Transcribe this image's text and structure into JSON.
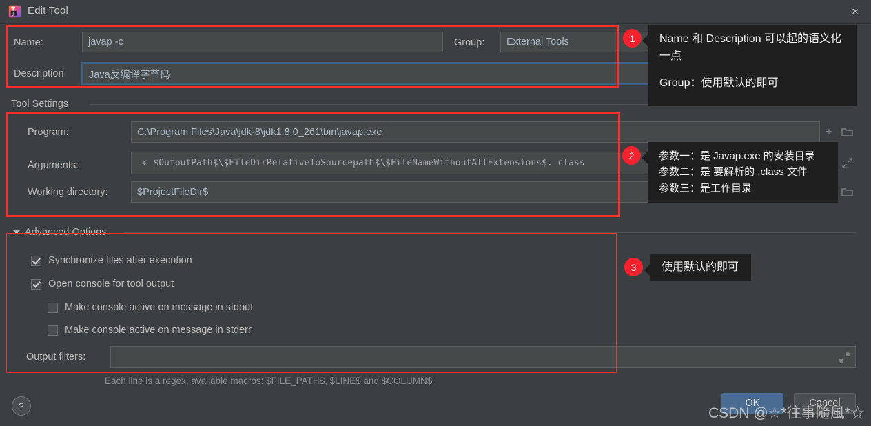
{
  "window": {
    "title": "Edit Tool",
    "app_icon": "intellij-idea-icon",
    "close_label": "×"
  },
  "form": {
    "name_label": "Name:",
    "name_value": "javap -c",
    "group_label": "Group:",
    "group_value": "External Tools",
    "description_label": "Description:",
    "description_value": "Java反编译字节码"
  },
  "tool_settings": {
    "section_title": "Tool Settings",
    "program_label": "Program:",
    "program_value": "C:\\Program Files\\Java\\jdk-8\\jdk1.8.0_261\\bin\\javap.exe",
    "arguments_label": "Arguments:",
    "arguments_value": "-c $OutputPath$\\$FileDirRelativeToSourcepath$\\$FileNameWithoutAllExtensions$. class",
    "working_directory_label": "Working directory:",
    "working_directory_value": "$ProjectFileDir$",
    "insert_macro_icon": "plus-icon",
    "browse_icon": "folder-icon",
    "expand_icon": "expand-icon"
  },
  "advanced": {
    "section_title": "Advanced Options",
    "collapse_icon": "chevron-down-icon",
    "checkboxes": [
      {
        "label": "Synchronize files after execution",
        "checked": true,
        "indent": false
      },
      {
        "label": "Open console for tool output",
        "checked": true,
        "indent": false
      },
      {
        "label": "Make console active on message in stdout",
        "checked": false,
        "indent": true
      },
      {
        "label": "Make console active on message in stderr",
        "checked": false,
        "indent": true
      }
    ],
    "output_filters_label": "Output filters:",
    "output_filters_value": "",
    "output_filters_expand_icon": "expand-icon",
    "hint": "Each line is a regex, available macros: $FILE_PATH$, $LINE$ and $COLUMN$"
  },
  "footer": {
    "help_label": "?",
    "ok_label": "OK",
    "cancel_label": "Cancel",
    "watermark": "CSDN @☆*往事隨風*☆"
  },
  "callouts": [
    {
      "number": "1",
      "lines": [
        "Name 和 Description 可以起的语义化",
        "一点",
        "",
        "Group：使用默认的即可"
      ]
    },
    {
      "number": "2",
      "lines": [
        "参数一：是 Javap.exe 的安装目录",
        "参数二：是 要解析的 .class 文件",
        "参数三：是工作目录"
      ]
    },
    {
      "number": "3",
      "lines": [
        "使用默认的即可"
      ]
    }
  ],
  "colors": {
    "dialog_bg": "#3c3f41",
    "field_bg": "#45494a",
    "accent_red": "#ff2d2d",
    "badge_red": "#f5222d",
    "focus_blue": "#3d6185",
    "ok_blue": "#4a6c92"
  }
}
